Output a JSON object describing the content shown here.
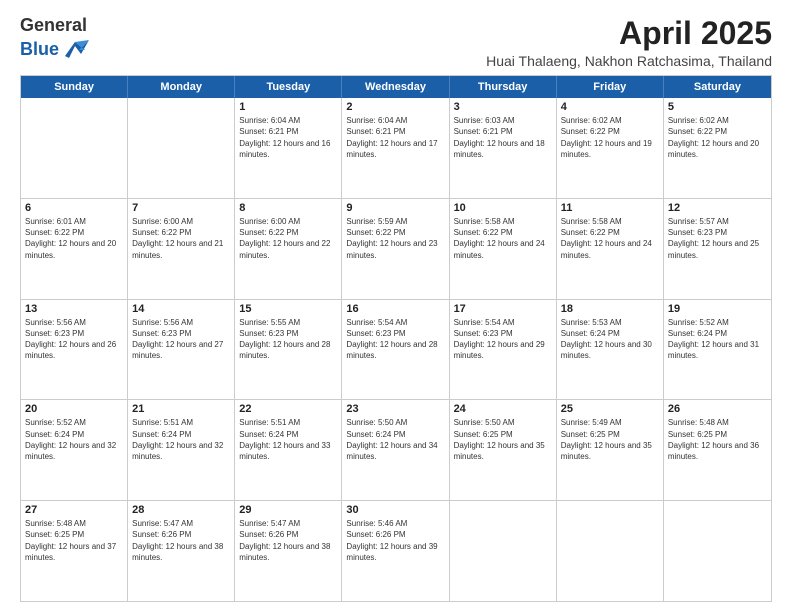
{
  "header": {
    "logo_general": "General",
    "logo_blue": "Blue",
    "month": "April 2025",
    "location": "Huai Thalaeng, Nakhon Ratchasima, Thailand"
  },
  "days_of_week": [
    "Sunday",
    "Monday",
    "Tuesday",
    "Wednesday",
    "Thursday",
    "Friday",
    "Saturday"
  ],
  "weeks": [
    [
      {
        "day": "",
        "empty": true
      },
      {
        "day": "",
        "empty": true
      },
      {
        "day": "1",
        "sunrise": "6:04 AM",
        "sunset": "6:21 PM",
        "daylight": "12 hours and 16 minutes."
      },
      {
        "day": "2",
        "sunrise": "6:04 AM",
        "sunset": "6:21 PM",
        "daylight": "12 hours and 17 minutes."
      },
      {
        "day": "3",
        "sunrise": "6:03 AM",
        "sunset": "6:21 PM",
        "daylight": "12 hours and 18 minutes."
      },
      {
        "day": "4",
        "sunrise": "6:02 AM",
        "sunset": "6:22 PM",
        "daylight": "12 hours and 19 minutes."
      },
      {
        "day": "5",
        "sunrise": "6:02 AM",
        "sunset": "6:22 PM",
        "daylight": "12 hours and 20 minutes."
      }
    ],
    [
      {
        "day": "6",
        "sunrise": "6:01 AM",
        "sunset": "6:22 PM",
        "daylight": "12 hours and 20 minutes."
      },
      {
        "day": "7",
        "sunrise": "6:00 AM",
        "sunset": "6:22 PM",
        "daylight": "12 hours and 21 minutes."
      },
      {
        "day": "8",
        "sunrise": "6:00 AM",
        "sunset": "6:22 PM",
        "daylight": "12 hours and 22 minutes."
      },
      {
        "day": "9",
        "sunrise": "5:59 AM",
        "sunset": "6:22 PM",
        "daylight": "12 hours and 23 minutes."
      },
      {
        "day": "10",
        "sunrise": "5:58 AM",
        "sunset": "6:22 PM",
        "daylight": "12 hours and 24 minutes."
      },
      {
        "day": "11",
        "sunrise": "5:58 AM",
        "sunset": "6:22 PM",
        "daylight": "12 hours and 24 minutes."
      },
      {
        "day": "12",
        "sunrise": "5:57 AM",
        "sunset": "6:23 PM",
        "daylight": "12 hours and 25 minutes."
      }
    ],
    [
      {
        "day": "13",
        "sunrise": "5:56 AM",
        "sunset": "6:23 PM",
        "daylight": "12 hours and 26 minutes."
      },
      {
        "day": "14",
        "sunrise": "5:56 AM",
        "sunset": "6:23 PM",
        "daylight": "12 hours and 27 minutes."
      },
      {
        "day": "15",
        "sunrise": "5:55 AM",
        "sunset": "6:23 PM",
        "daylight": "12 hours and 28 minutes."
      },
      {
        "day": "16",
        "sunrise": "5:54 AM",
        "sunset": "6:23 PM",
        "daylight": "12 hours and 28 minutes."
      },
      {
        "day": "17",
        "sunrise": "5:54 AM",
        "sunset": "6:23 PM",
        "daylight": "12 hours and 29 minutes."
      },
      {
        "day": "18",
        "sunrise": "5:53 AM",
        "sunset": "6:24 PM",
        "daylight": "12 hours and 30 minutes."
      },
      {
        "day": "19",
        "sunrise": "5:52 AM",
        "sunset": "6:24 PM",
        "daylight": "12 hours and 31 minutes."
      }
    ],
    [
      {
        "day": "20",
        "sunrise": "5:52 AM",
        "sunset": "6:24 PM",
        "daylight": "12 hours and 32 minutes."
      },
      {
        "day": "21",
        "sunrise": "5:51 AM",
        "sunset": "6:24 PM",
        "daylight": "12 hours and 32 minutes."
      },
      {
        "day": "22",
        "sunrise": "5:51 AM",
        "sunset": "6:24 PM",
        "daylight": "12 hours and 33 minutes."
      },
      {
        "day": "23",
        "sunrise": "5:50 AM",
        "sunset": "6:24 PM",
        "daylight": "12 hours and 34 minutes."
      },
      {
        "day": "24",
        "sunrise": "5:50 AM",
        "sunset": "6:25 PM",
        "daylight": "12 hours and 35 minutes."
      },
      {
        "day": "25",
        "sunrise": "5:49 AM",
        "sunset": "6:25 PM",
        "daylight": "12 hours and 35 minutes."
      },
      {
        "day": "26",
        "sunrise": "5:48 AM",
        "sunset": "6:25 PM",
        "daylight": "12 hours and 36 minutes."
      }
    ],
    [
      {
        "day": "27",
        "sunrise": "5:48 AM",
        "sunset": "6:25 PM",
        "daylight": "12 hours and 37 minutes."
      },
      {
        "day": "28",
        "sunrise": "5:47 AM",
        "sunset": "6:26 PM",
        "daylight": "12 hours and 38 minutes."
      },
      {
        "day": "29",
        "sunrise": "5:47 AM",
        "sunset": "6:26 PM",
        "daylight": "12 hours and 38 minutes."
      },
      {
        "day": "30",
        "sunrise": "5:46 AM",
        "sunset": "6:26 PM",
        "daylight": "12 hours and 39 minutes."
      },
      {
        "day": "",
        "empty": true
      },
      {
        "day": "",
        "empty": true
      },
      {
        "day": "",
        "empty": true
      }
    ]
  ]
}
